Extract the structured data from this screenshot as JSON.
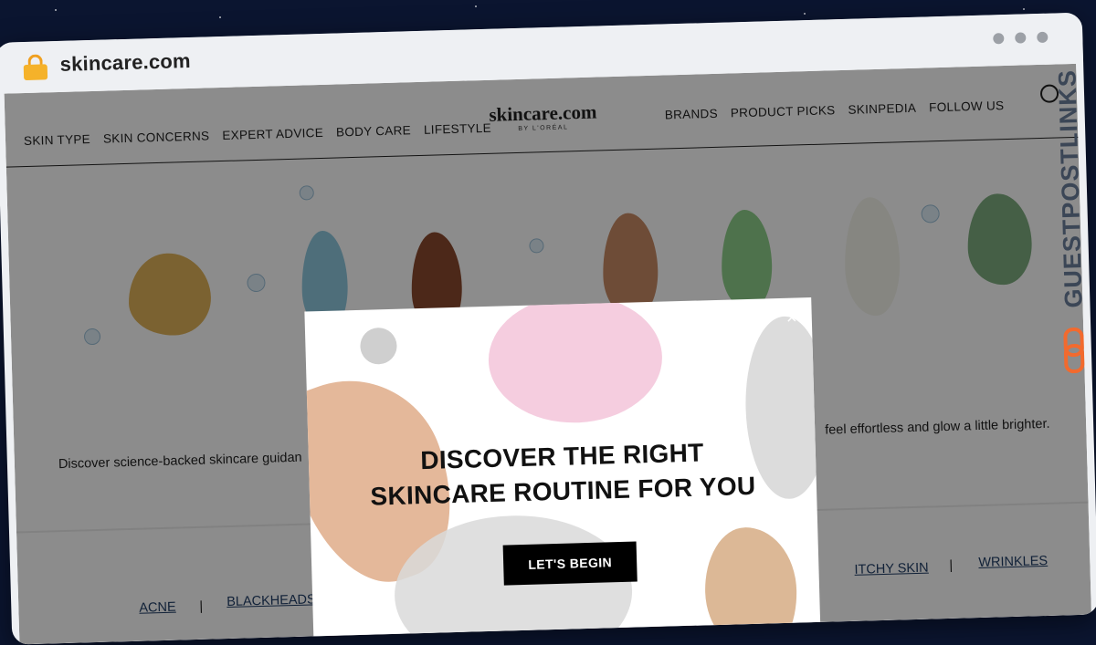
{
  "browser": {
    "url": "skincare.com"
  },
  "nav": {
    "left": [
      "SKIN TYPE",
      "SKIN CONCERNS",
      "EXPERT ADVICE",
      "BODY CARE",
      "LIFESTYLE"
    ],
    "right": [
      "BRANDS",
      "PRODUCT PICKS",
      "SKINPEDIA",
      "FOLLOW US"
    ]
  },
  "logo": {
    "main": "skincare.com",
    "sub": "BY L'ORÉAL"
  },
  "hero": {
    "text_left": "Discover science-backed skincare guidan",
    "text_right": "feel effortless and glow a little brighter."
  },
  "topics": [
    "ACNE",
    "BLACKHEADS",
    "ITCHY SKIN",
    "WRINKLES"
  ],
  "topic_separator": "|",
  "modal": {
    "title_line1": "DISCOVER THE RIGHT",
    "title_line2": "SKINCARE ROUTINE FOR YOU",
    "cta": "LET'S BEGIN",
    "close": "×"
  },
  "watermark": {
    "text": "GUESTPOSTLINKS"
  },
  "colors": {
    "accent": "#f26a2e",
    "modal_button": "#000000",
    "link": "#1f3d66"
  }
}
